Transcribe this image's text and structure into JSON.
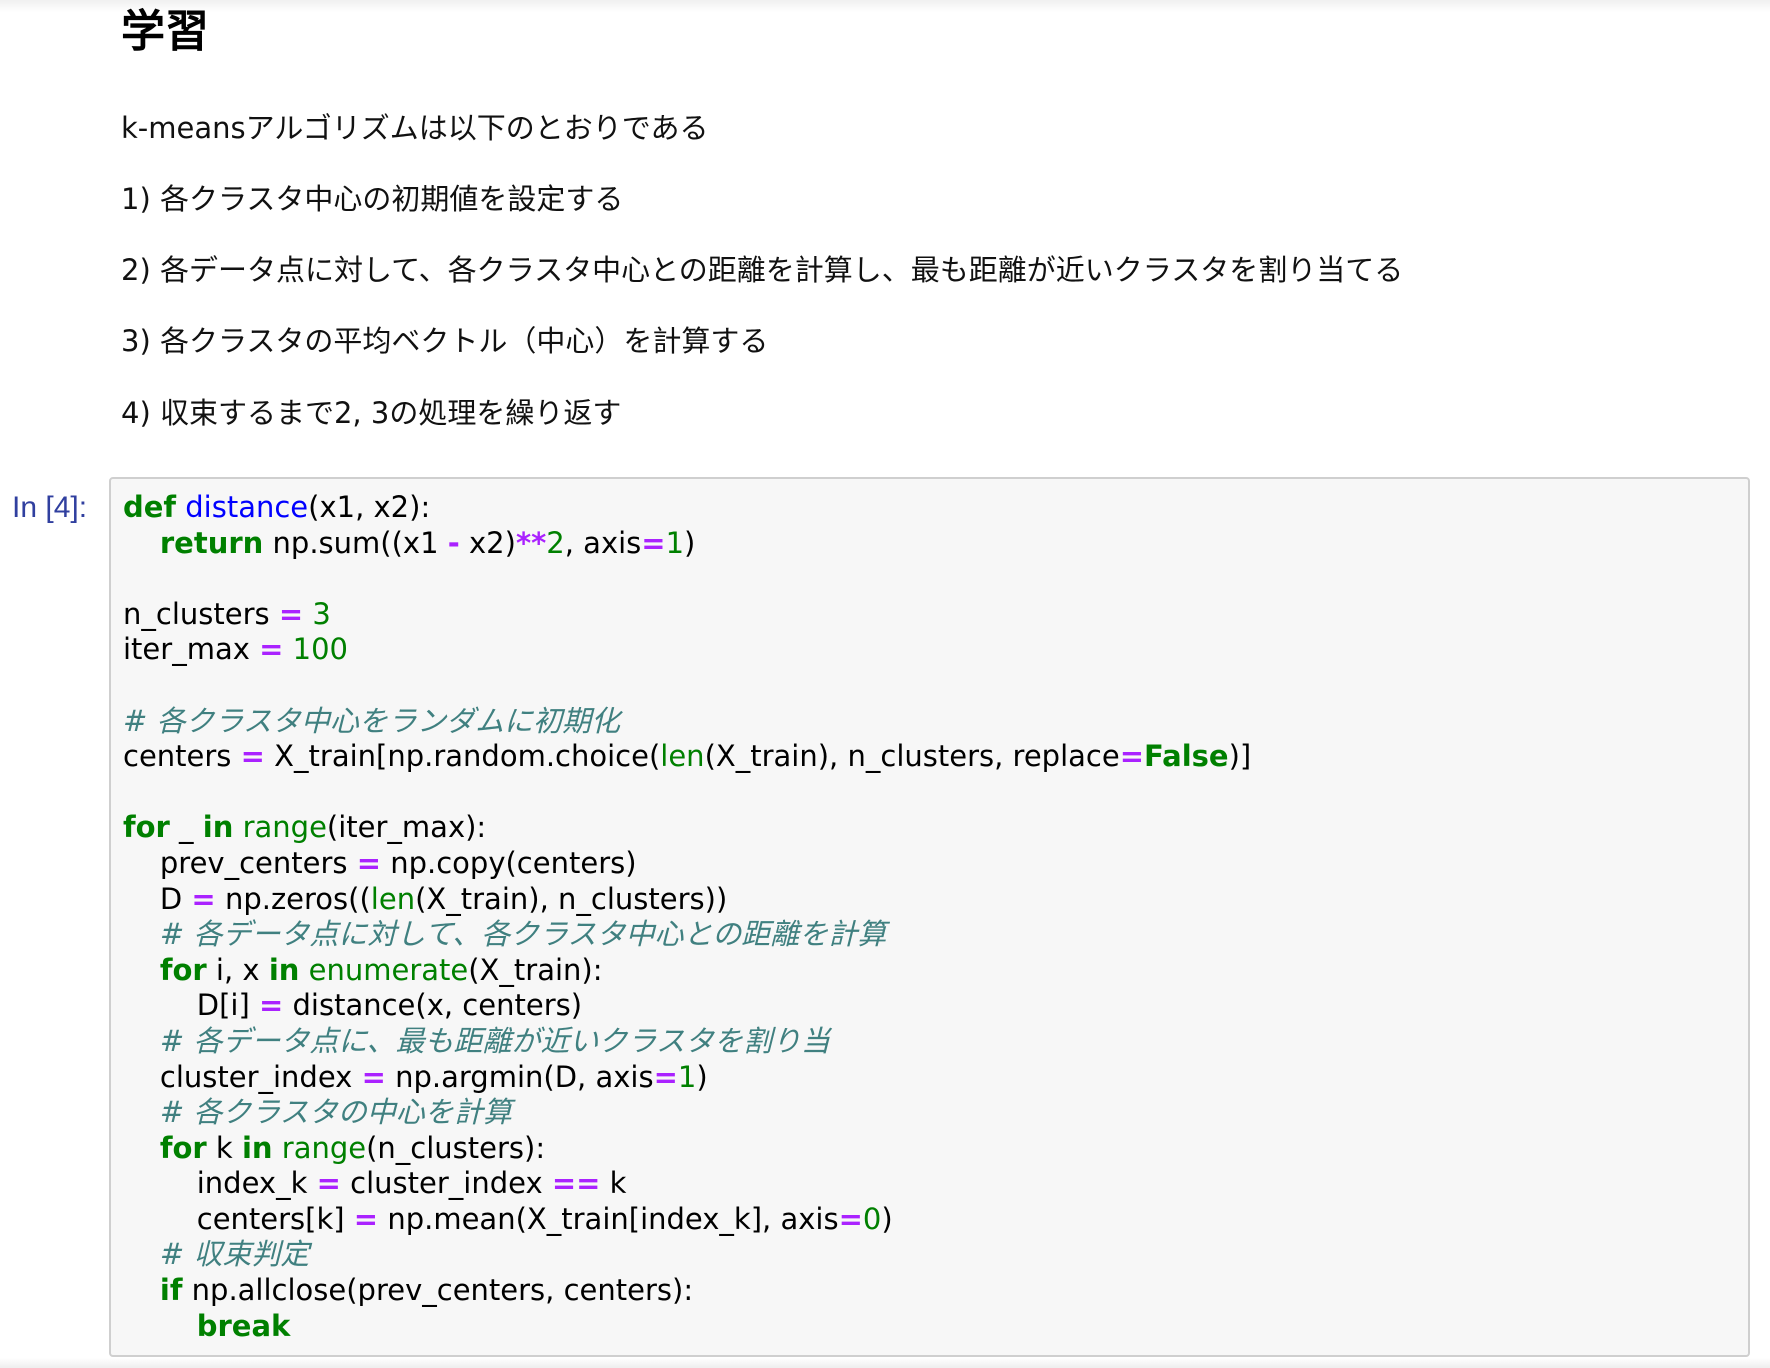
{
  "markdown": {
    "heading": "学習",
    "paragraphs": [
      "k-meansアルゴリズムは以下のとおりである",
      "1) 各クラスタ中心の初期値を設定する",
      "2) 各データ点に対して、各クラスタ中心との距離を計算し、最も距離が近いクラスタを割り当てる",
      "3) 各クラスタの平均ベクトル（中心）を計算する",
      "4) 収束するまで2, 3の処理を繰り返す"
    ]
  },
  "code_cell": {
    "prompt": "In [4]:",
    "lines": [
      "def distance(x1, x2):",
      "    return np.sum((x1 - x2)**2, axis=1)",
      "",
      "n_clusters = 3",
      "iter_max = 100",
      "",
      "# 各クラスタ中心をランダムに初期化",
      "centers = X_train[np.random.choice(len(X_train), n_clusters, replace=False)]",
      "",
      "for _ in range(iter_max):",
      "    prev_centers = np.copy(centers)",
      "    D = np.zeros((len(X_train), n_clusters))",
      "    # 各データ点に対して、各クラスタ中心との距離を計算",
      "    for i, x in enumerate(X_train):",
      "        D[i] = distance(x, centers)",
      "    # 各データ点に、最も距離が近いクラスタを割り当",
      "    cluster_index = np.argmin(D, axis=1)",
      "    # 各クラスタの中心を計算",
      "    for k in range(n_clusters):",
      "        index_k = cluster_index == k",
      "        centers[k] = np.mean(X_train[index_k], axis=0)",
      "    # 収束判定",
      "    if np.allclose(prev_centers, centers):",
      "        break"
    ]
  },
  "colors": {
    "prompt": "#303f9f",
    "keyword": "#008000",
    "function_name": "#0000ff",
    "operator": "#aa22ff",
    "comment": "#408080",
    "cell_background": "#f7f7f7",
    "cell_border": "#cfcfcf"
  }
}
